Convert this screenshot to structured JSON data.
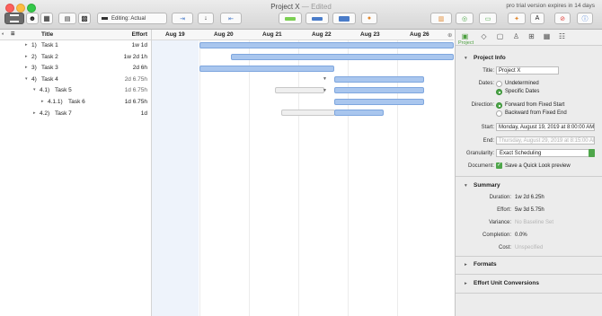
{
  "window": {
    "title": "Project X",
    "edited": "— Edited",
    "trial": "pro trial version expires in 14 days"
  },
  "toolbar": {
    "editing_label": "Editing: Actual"
  },
  "outline": {
    "col_title": "Title",
    "col_effort": "Effort",
    "rows": [
      {
        "num": "1)",
        "name": "Task 1",
        "effort": "1w 1d"
      },
      {
        "num": "2)",
        "name": "Task 2",
        "effort": "1w 2d 1h"
      },
      {
        "num": "3)",
        "name": "Task 3",
        "effort": "2d 6h"
      },
      {
        "num": "4)",
        "name": "Task 4",
        "effort": "2d 6.75h"
      },
      {
        "num": "4.1)",
        "name": "Task 5",
        "effort": "1d 6.75h"
      },
      {
        "num": "4.1.1)",
        "name": "Task 6",
        "effort": "1d 6.75h"
      },
      {
        "num": "4.2)",
        "name": "Task 7",
        "effort": "1d"
      }
    ]
  },
  "gantt": {
    "days": [
      "Aug 19",
      "Aug 20",
      "Aug 21",
      "Aug 22",
      "Aug 23",
      "Aug 26"
    ]
  },
  "inspector": {
    "tab_label": "Project",
    "project_info": {
      "heading": "Project Info",
      "title_label": "Title:",
      "title_value": "Project X",
      "dates_label": "Dates:",
      "dates_opt1": "Undetermined",
      "dates_opt2": "Specific Dates",
      "direction_label": "Direction:",
      "dir_opt1": "Forward from Fixed Start",
      "dir_opt2": "Backward from Fixed End",
      "start_label": "Start:",
      "start_value": "Monday, August 19, 2019 at 8:00:00 AM",
      "end_label": "End:",
      "end_value": "Thursday, August 29, 2019 at 8:15:00 AM",
      "granularity_label": "Granularity:",
      "granularity_value": "Exact Scheduling",
      "document_label": "Document:",
      "document_value": "Save a Quick Look preview"
    },
    "summary": {
      "heading": "Summary",
      "duration_label": "Duration:",
      "duration_value": "1w 2d 6.25h",
      "effort_label": "Effort:",
      "effort_value": "5w 3d 5.75h",
      "variance_label": "Variance:",
      "variance_value": "No Baseline Set",
      "completion_label": "Completion:",
      "completion_value": "0.0%",
      "cost_label": "Cost:",
      "cost_value": "Unspecified"
    },
    "formats_heading": "Formats",
    "effort_units_heading": "Effort Unit Conversions"
  }
}
